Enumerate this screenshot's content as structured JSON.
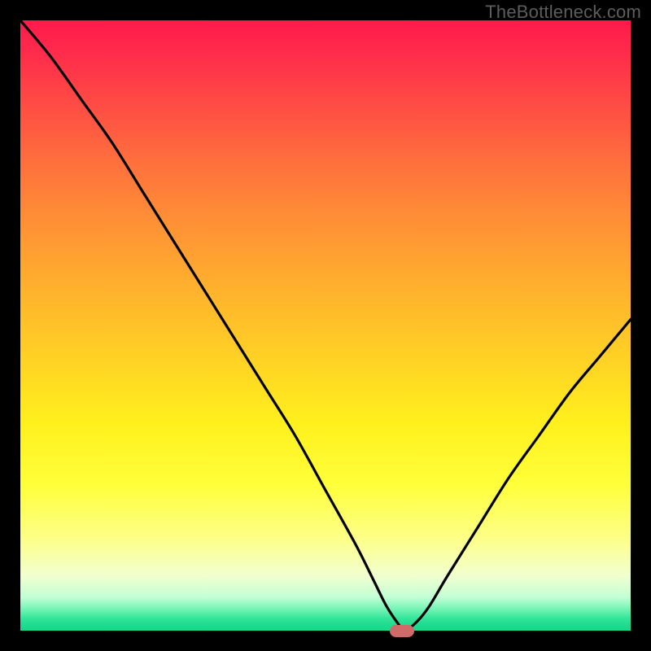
{
  "watermark": "TheBottleneck.com",
  "colors": {
    "background": "#000000",
    "curve": "#000000",
    "marker": "#cf6a6a",
    "watermark_text": "#5d5d5d"
  },
  "chart_data": {
    "type": "line",
    "title": "",
    "xlabel": "",
    "ylabel": "",
    "xlim": [
      0,
      100
    ],
    "ylim": [
      0,
      100
    ],
    "grid": false,
    "legend": false,
    "annotations": [
      {
        "text": "TheBottleneck.com",
        "pos": "top-right"
      }
    ],
    "background_gradient_stops": [
      {
        "pct": 0.0,
        "value": 100,
        "color": "#ff1a4b"
      },
      {
        "pct": 0.5,
        "value": 50,
        "color": "#ffd324"
      },
      {
        "pct": 0.78,
        "value": 22,
        "color": "#ffff3a"
      },
      {
        "pct": 0.95,
        "value": 5,
        "color": "#c3ffd5"
      },
      {
        "pct": 1.0,
        "value": 0,
        "color": "#1bd78c"
      }
    ],
    "series": [
      {
        "name": "bottleneck_curve",
        "x": [
          0.0,
          5.0,
          10.0,
          15.0,
          20.0,
          25.0,
          30.0,
          35.0,
          40.0,
          45.0,
          50.0,
          55.0,
          58.0,
          60.0,
          62.0,
          63.0,
          65.0,
          67.0,
          70.0,
          75.0,
          80.0,
          85.0,
          90.0,
          95.0,
          100.0
        ],
        "values": [
          100.0,
          94.0,
          87.0,
          80.0,
          72.0,
          64.0,
          56.0,
          48.0,
          40.0,
          32.0,
          23.0,
          14.0,
          8.0,
          4.0,
          1.0,
          0.0,
          1.5,
          4.0,
          9.0,
          17.0,
          25.0,
          32.0,
          39.0,
          45.0,
          51.0
        ]
      }
    ],
    "marker": {
      "x": 62.5,
      "y": 0.0,
      "width_x": 4.0,
      "height_y": 2.0
    }
  }
}
